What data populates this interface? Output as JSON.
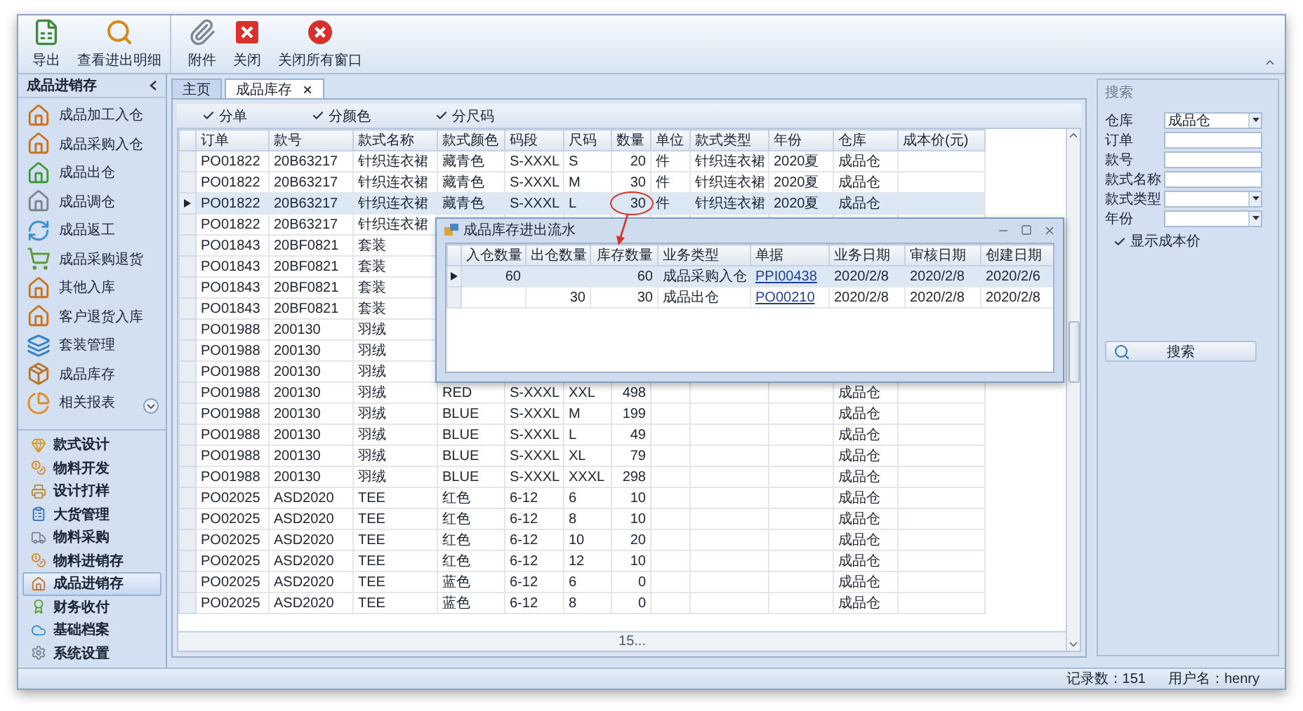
{
  "toolbar": {
    "buttons": [
      {
        "label": "导出"
      },
      {
        "label": "查看进出明细"
      },
      {
        "label": "附件"
      },
      {
        "label": "关闭"
      },
      {
        "label": "关闭所有窗口"
      }
    ]
  },
  "sidebar": {
    "title": "成品进销存",
    "items": [
      {
        "label": "成品加工入仓"
      },
      {
        "label": "成品采购入仓"
      },
      {
        "label": "成品出仓"
      },
      {
        "label": "成品调仓"
      },
      {
        "label": "成品返工"
      },
      {
        "label": "成品采购退货"
      },
      {
        "label": "其他入库"
      },
      {
        "label": "客户退货入库"
      },
      {
        "label": "套装管理"
      },
      {
        "label": "成品库存"
      },
      {
        "label": "相关报表"
      }
    ],
    "groups": [
      {
        "label": "款式设计",
        "selected": false
      },
      {
        "label": "物料开发",
        "selected": false
      },
      {
        "label": "设计打样",
        "selected": false
      },
      {
        "label": "大货管理",
        "selected": false
      },
      {
        "label": "物料采购",
        "selected": false
      },
      {
        "label": "物料进销存",
        "selected": false
      },
      {
        "label": "成品进销存",
        "selected": true
      },
      {
        "label": "财务收付",
        "selected": false
      },
      {
        "label": "基础档案",
        "selected": false
      },
      {
        "label": "系统设置",
        "selected": false
      }
    ]
  },
  "tabs": [
    {
      "label": "主页",
      "selected": false
    },
    {
      "label": "成品库存",
      "selected": true
    }
  ],
  "options": [
    {
      "label": "分单",
      "checked": true
    },
    {
      "label": "分颜色",
      "checked": true
    },
    {
      "label": "分尺码",
      "checked": true
    }
  ],
  "grid": {
    "columns": [
      {
        "label": "订单"
      },
      {
        "label": "款号"
      },
      {
        "label": "款式名称"
      },
      {
        "label": "款式颜色"
      },
      {
        "label": "码段"
      },
      {
        "label": "尺码"
      },
      {
        "label": "数量"
      },
      {
        "label": "单位"
      },
      {
        "label": "款式类型"
      },
      {
        "label": "年份"
      },
      {
        "label": "仓库"
      },
      {
        "label": "成本价(元)"
      }
    ],
    "rows": [
      {
        "selected": false,
        "order": "PO01822",
        "style_no": "20B63217",
        "style_name": "针织连衣裙",
        "style_color": "藏青色",
        "size_range": "S-XXXL",
        "size": "S",
        "qty": "20",
        "unit": "件",
        "style_type": "针织连衣裙",
        "year": "2020夏",
        "warehouse": "成品仓"
      },
      {
        "selected": false,
        "order": "PO01822",
        "style_no": "20B63217",
        "style_name": "针织连衣裙",
        "style_color": "藏青色",
        "size_range": "S-XXXL",
        "size": "M",
        "qty": "30",
        "unit": "件",
        "style_type": "针织连衣裙",
        "year": "2020夏",
        "warehouse": "成品仓"
      },
      {
        "selected": true,
        "order": "PO01822",
        "style_no": "20B63217",
        "style_name": "针织连衣裙",
        "style_color": "藏青色",
        "size_range": "S-XXXL",
        "size": "L",
        "qty": "30",
        "unit": "件",
        "style_type": "针织连衣裙",
        "year": "2020夏",
        "warehouse": "成品仓"
      },
      {
        "selected": false,
        "order": "PO01822",
        "style_no": "20B63217",
        "style_name": "针织连衣裙"
      },
      {
        "selected": false,
        "order": "PO01843",
        "style_no": "20BF0821",
        "style_name": "套装"
      },
      {
        "selected": false,
        "order": "PO01843",
        "style_no": "20BF0821",
        "style_name": "套装"
      },
      {
        "selected": false,
        "order": "PO01843",
        "style_no": "20BF0821",
        "style_name": "套装"
      },
      {
        "selected": false,
        "order": "PO01843",
        "style_no": "20BF0821",
        "style_name": "套装"
      },
      {
        "selected": false,
        "order": "PO01988",
        "style_no": "200130",
        "style_name": "羽绒"
      },
      {
        "selected": false,
        "order": "PO01988",
        "style_no": "200130",
        "style_name": "羽绒"
      },
      {
        "selected": false,
        "order": "PO01988",
        "style_no": "200130",
        "style_name": "羽绒"
      },
      {
        "selected": false,
        "order": "PO01988",
        "style_no": "200130",
        "style_name": "羽绒",
        "style_color": "RED",
        "size_range": "S-XXXL",
        "size": "XXL",
        "qty": "498",
        "warehouse": "成品仓"
      },
      {
        "selected": false,
        "order": "PO01988",
        "style_no": "200130",
        "style_name": "羽绒",
        "style_color": "BLUE",
        "size_range": "S-XXXL",
        "size": "M",
        "qty": "199",
        "warehouse": "成品仓"
      },
      {
        "selected": false,
        "order": "PO01988",
        "style_no": "200130",
        "style_name": "羽绒",
        "style_color": "BLUE",
        "size_range": "S-XXXL",
        "size": "L",
        "qty": "49",
        "warehouse": "成品仓"
      },
      {
        "selected": false,
        "order": "PO01988",
        "style_no": "200130",
        "style_name": "羽绒",
        "style_color": "BLUE",
        "size_range": "S-XXXL",
        "size": "XL",
        "qty": "79",
        "warehouse": "成品仓"
      },
      {
        "selected": false,
        "order": "PO01988",
        "style_no": "200130",
        "style_name": "羽绒",
        "style_color": "BLUE",
        "size_range": "S-XXXL",
        "size": "XXXL",
        "qty": "298",
        "warehouse": "成品仓"
      },
      {
        "selected": false,
        "order": "PO02025",
        "style_no": "ASD2020",
        "style_name": "TEE",
        "style_color": "红色",
        "size_range": "6-12",
        "size": "6",
        "qty": "10",
        "warehouse": "成品仓"
      },
      {
        "selected": false,
        "order": "PO02025",
        "style_no": "ASD2020",
        "style_name": "TEE",
        "style_color": "红色",
        "size_range": "6-12",
        "size": "8",
        "qty": "10",
        "warehouse": "成品仓"
      },
      {
        "selected": false,
        "order": "PO02025",
        "style_no": "ASD2020",
        "style_name": "TEE",
        "style_color": "红色",
        "size_range": "6-12",
        "size": "10",
        "qty": "20",
        "warehouse": "成品仓"
      },
      {
        "selected": false,
        "order": "PO02025",
        "style_no": "ASD2020",
        "style_name": "TEE",
        "style_color": "红色",
        "size_range": "6-12",
        "size": "12",
        "qty": "10",
        "warehouse": "成品仓"
      },
      {
        "selected": false,
        "order": "PO02025",
        "style_no": "ASD2020",
        "style_name": "TEE",
        "style_color": "蓝色",
        "size_range": "6-12",
        "size": "6",
        "qty": "0",
        "warehouse": "成品仓"
      },
      {
        "selected": false,
        "order": "PO02025",
        "style_no": "ASD2020",
        "style_name": "TEE",
        "style_color": "蓝色",
        "size_range": "6-12",
        "size": "8",
        "qty": "0",
        "warehouse": "成品仓"
      }
    ],
    "footer_qty": "15..."
  },
  "popup": {
    "title": "成品库存进出流水",
    "columns": [
      {
        "label": "入仓数量"
      },
      {
        "label": "出仓数量"
      },
      {
        "label": "库存数量"
      },
      {
        "label": "业务类型"
      },
      {
        "label": "单据"
      },
      {
        "label": "业务日期"
      },
      {
        "label": "审核日期"
      },
      {
        "label": "创建日期"
      }
    ],
    "rows": [
      {
        "selected": true,
        "in_qty": "60",
        "stock_qty": "60",
        "biz_type": "成品采购入仓",
        "doc": "PPI00438",
        "biz_date": "2020/2/8",
        "audit_date": "2020/2/8",
        "created_date": "2020/2/6"
      },
      {
        "selected": false,
        "out_qty": "30",
        "stock_qty": "30",
        "biz_type": "成品出仓",
        "doc": "PO00210",
        "biz_date": "2020/2/8",
        "audit_date": "2020/2/8",
        "created_date": "2020/2/8"
      }
    ]
  },
  "search_panel": {
    "title": "搜索",
    "fields": [
      {
        "label": "仓库",
        "kind": "dropdown",
        "value": "成品仓"
      },
      {
        "label": "订单",
        "kind": "text"
      },
      {
        "label": "款号",
        "kind": "text"
      },
      {
        "label": "款式名称",
        "kind": "text"
      },
      {
        "label": "款式类型",
        "kind": "dropdown"
      },
      {
        "label": "年份",
        "kind": "dropdown"
      }
    ],
    "show_cost": {
      "label": "显示成本价",
      "checked": true
    },
    "button": "搜索"
  },
  "status_bar": {
    "record_count": "记录数：151",
    "user": "用户名：henry"
  }
}
